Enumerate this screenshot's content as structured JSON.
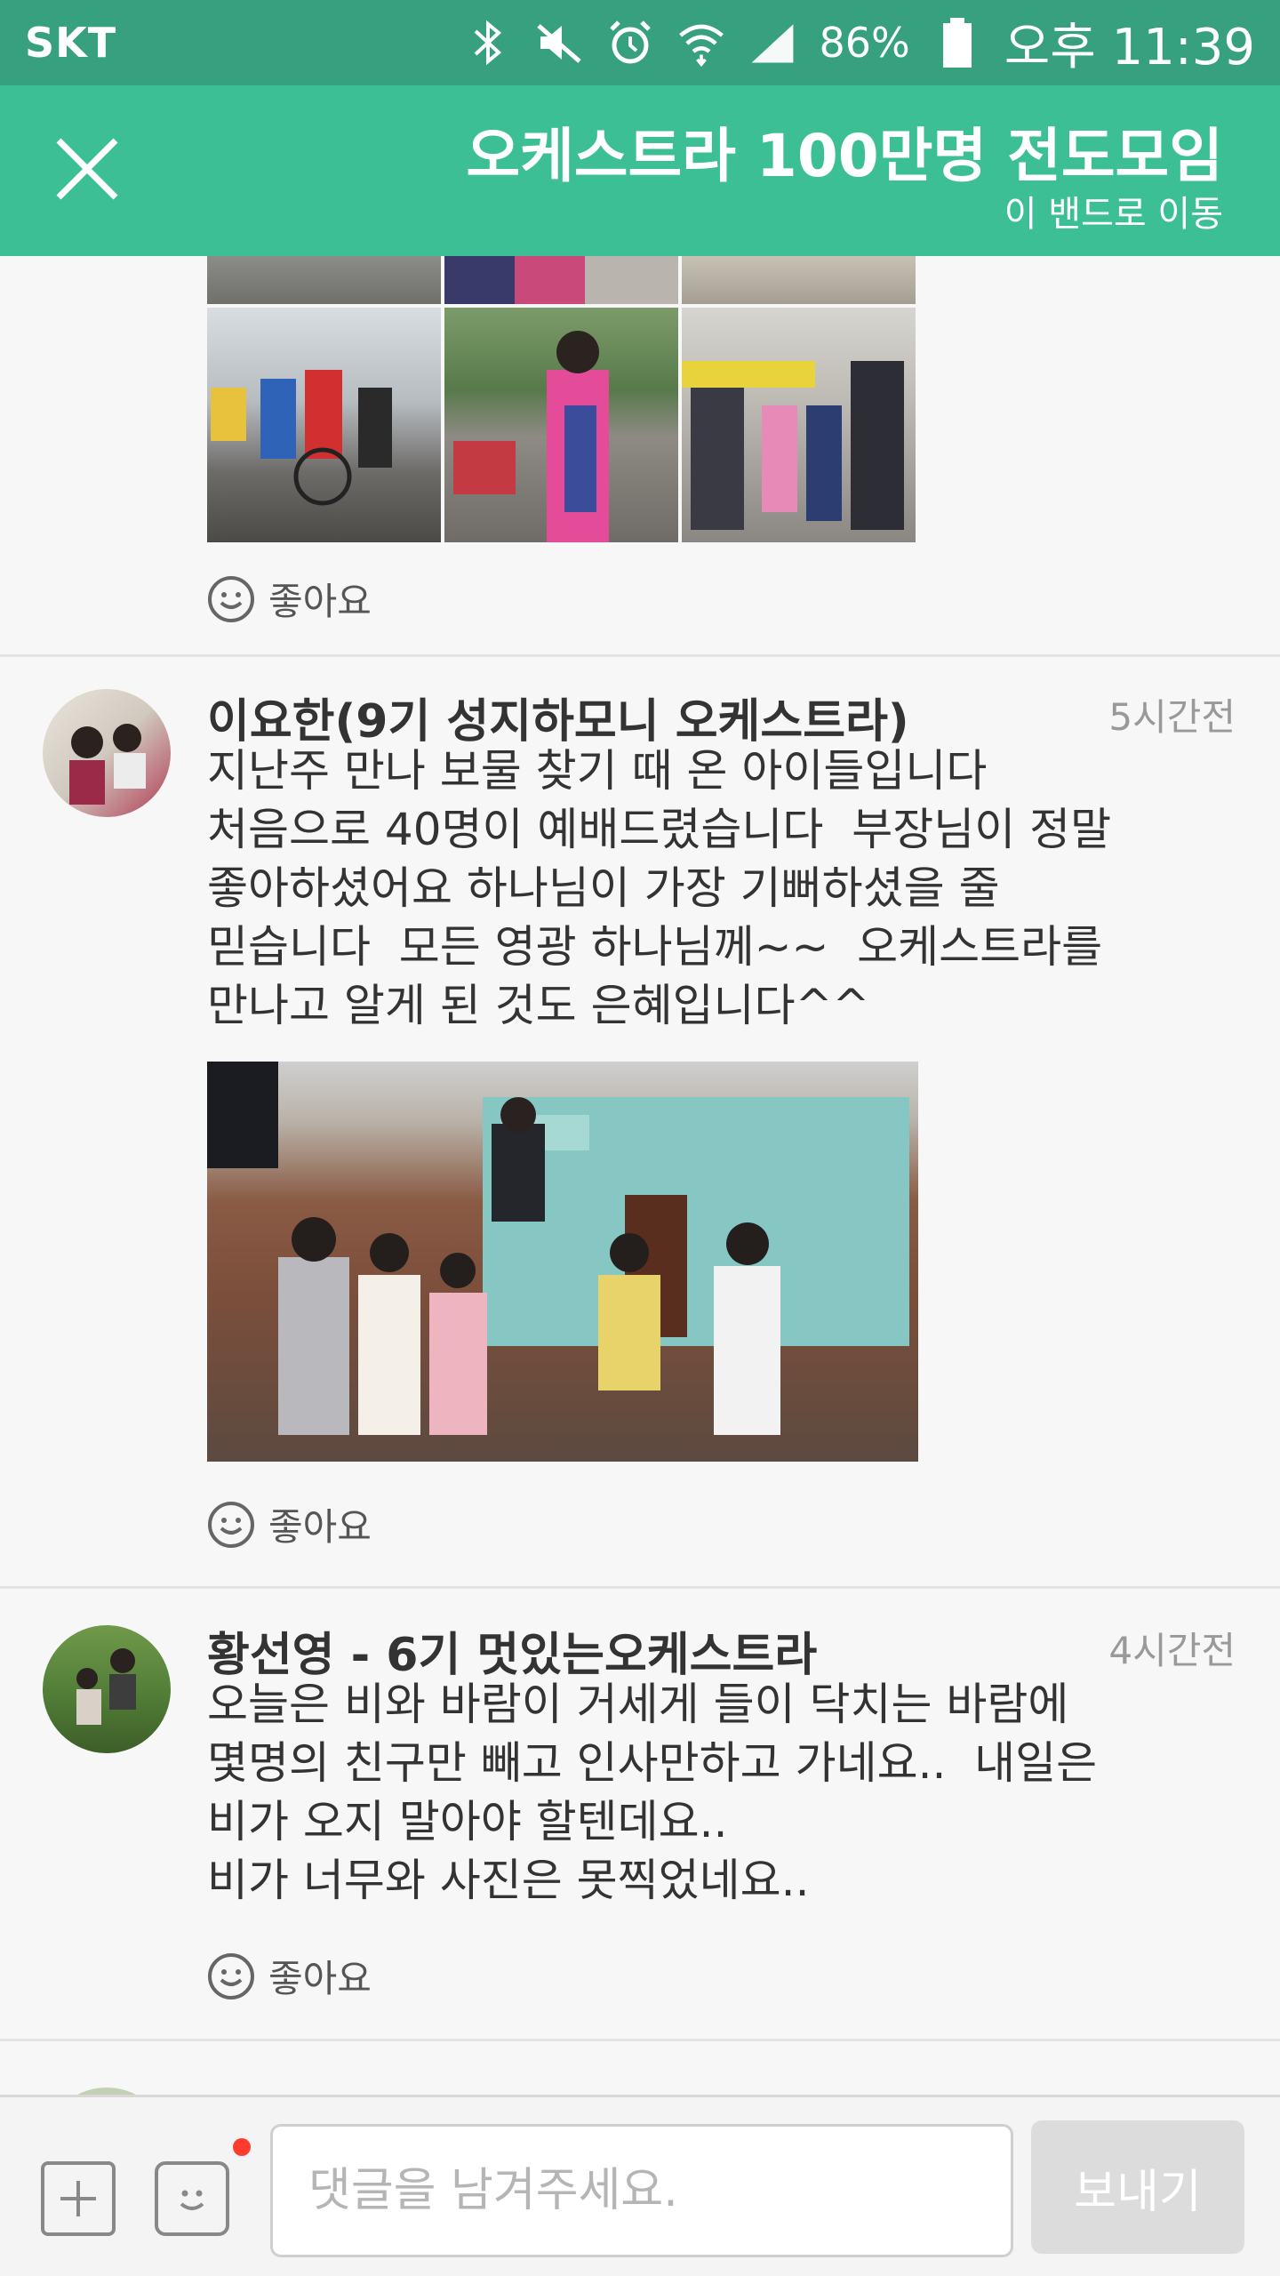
{
  "status_bar": {
    "carrier": "SKT",
    "battery": "86%",
    "time": "오후 11:39",
    "icons": [
      "bluetooth-icon",
      "mute-icon",
      "alarm-icon",
      "wifi-icon",
      "signal-icon",
      "battery-icon"
    ]
  },
  "header": {
    "title": "오케스트라 100만명 전도모임",
    "subtitle": "이 밴드로 이동",
    "bg_color": "#3dbf95"
  },
  "feed": {
    "top_post": {
      "like_label": "좋아요"
    },
    "posts": [
      {
        "author": "이요한(9기 성지하모니 오케스트라)",
        "time": "5시간전",
        "text": "지난주 만나 보물 찾기 때 온 아이들입니다\n처음으로 40명이 예배드렸습니다  부장님이 정말\n좋아하셨어요 하나님이 가장 기뻐하셨을 줄\n믿습니다  모든 영광 하나님께~~  오케스트라를\n만나고 알게 된 것도 은혜입니다^^",
        "like_label": "좋아요"
      },
      {
        "author": "황선영 - 6기 멋있는오케스트라",
        "time": "4시간전",
        "text": "오늘은 비와 바람이 거세게 들이 닥치는 바람에\n몇명의 친구만 빼고 인사만하고 가네요..  내일은\n비가 오지 말아야 할텐데요..\n비가 너무와 사진은 못찍었네요..",
        "like_label": "좋아요"
      }
    ]
  },
  "comment_bar": {
    "placeholder": "댓글을 남겨주세요.",
    "send_label": "보내기"
  }
}
